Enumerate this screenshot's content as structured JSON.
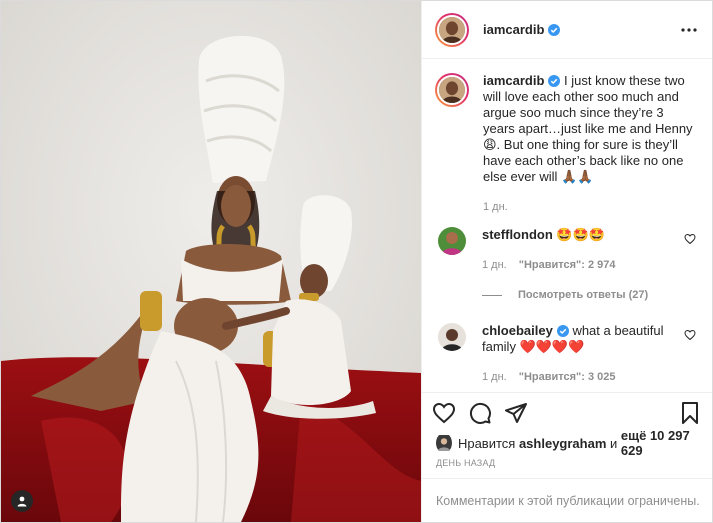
{
  "post": {
    "username": "iamcardib",
    "verified": true,
    "caption": "I just know these two will love each other soo much and argue soo much since they’re 3 years apart…just like me and Henny 😩. But one thing for sure is they’ll have each other’s back like no one else ever will 🙏🏾🙏🏾",
    "caption_time": "1 дн."
  },
  "comments": [
    {
      "username": "stefflondon",
      "verified": false,
      "text": "🤩🤩🤩",
      "time": "1 дн.",
      "likes": "\"Нравится\": 2 974",
      "view_replies": "Посмотреть ответы (27)"
    },
    {
      "username": "chloebailey",
      "verified": true,
      "text": "what a beautiful family ❤️❤️❤️❤️",
      "time": "1 дн.",
      "likes": "\"Нравится\": 3 025"
    }
  ],
  "likes": {
    "prefix": "Нравится",
    "user": "ashleygraham",
    "joiner": "и",
    "others": "ещё 10 297 629"
  },
  "posted_ago": "ДЕНЬ НАЗАД",
  "comments_limited": "Комментарии к этой публикации ограничены.",
  "icons": [
    "more-options-icon",
    "verified-badge-icon",
    "heart-icon",
    "comment-icon",
    "share-icon",
    "bookmark-icon",
    "tagged-user-icon"
  ],
  "colors": {
    "verified": "#3897f0",
    "muted": "#8e8e8e",
    "text": "#262626",
    "border": "#efefef"
  }
}
